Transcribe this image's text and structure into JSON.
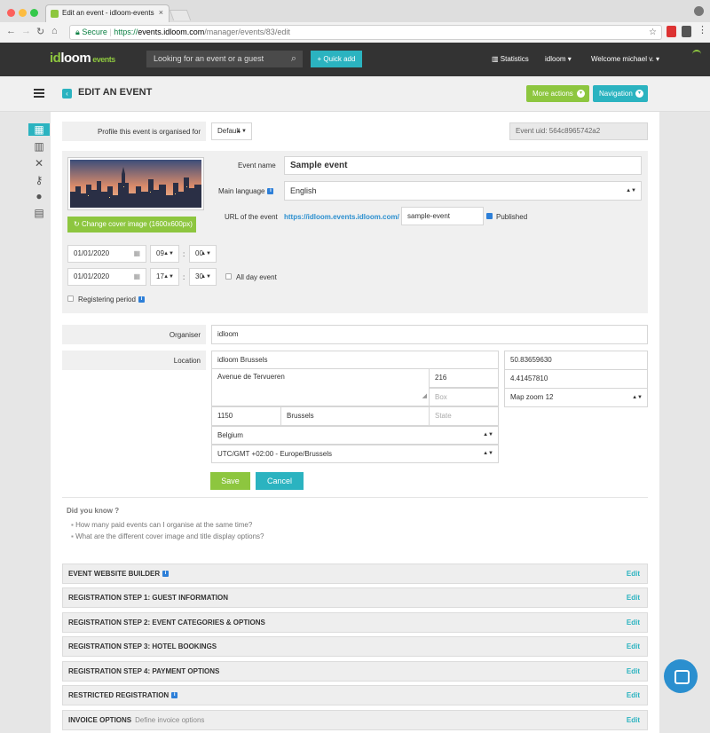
{
  "browser": {
    "tab_title": "Edit an event - idloom-events",
    "url_secure": "Secure",
    "url_protocol": "https://",
    "url_host": "events.idloom.com",
    "url_path": "/manager/events/83/edit"
  },
  "header": {
    "logo_id": "id",
    "logo_loom": "loom",
    "logo_events": "events",
    "search_placeholder": "Looking for an event or a guest",
    "quick_add": "+ Quick add",
    "statistics": "Statistics",
    "account": "idloom ▾",
    "welcome": "Welcome michael v. ▾"
  },
  "subbar": {
    "title": "EDIT AN EVENT",
    "more_actions": "More actions",
    "navigation": "Navigation"
  },
  "sidebar": {
    "icons": [
      "calendar-icon",
      "chart-icon",
      "tools-icon",
      "key-icon",
      "user-icon",
      "card-icon"
    ]
  },
  "form": {
    "profile_label": "Profile this event is organised for",
    "profile_value": "Default",
    "event_uid": "Event uid: 564c8965742a2",
    "cover_button": "Change cover image (1600x600px)",
    "event_name_label": "Event name",
    "event_name_value": "Sample event",
    "main_language_label": "Main language",
    "main_language_value": "English",
    "url_label": "URL of the event",
    "url_prefix": "https://idloom.events.idloom.com/",
    "url_slug": "sample-event",
    "published_label": "Published",
    "start_date": "01/01/2020",
    "start_hour": "09",
    "start_min": "00",
    "end_date": "01/01/2020",
    "end_hour": "17",
    "end_min": "30",
    "colon": ":",
    "all_day_label": "All day event",
    "registering_period_label": "Registering period",
    "organiser_label": "Organiser",
    "organiser_value": "idloom",
    "location_label": "Location",
    "location_name": "idloom Brussels",
    "street": "Avenue de Tervueren",
    "number": "216",
    "box_placeholder": "Box",
    "zip": "1150",
    "city": "Brussels",
    "state_placeholder": "State",
    "country": "Belgium",
    "timezone": "UTC/GMT +02:00 - Europe/Brussels",
    "latitude": "50.83659630",
    "longitude": "4.41457810",
    "map_zoom": "Map zoom 12",
    "save": "Save",
    "cancel": "Cancel"
  },
  "did_you_know": {
    "title": "Did you know ?",
    "items": [
      "How many paid events can I organise at the same time?",
      "What are the different cover image and title display options?"
    ]
  },
  "sections": [
    {
      "label": "EVENT WEBSITE BUILDER",
      "sub": "",
      "edit": "Edit"
    },
    {
      "label": "REGISTRATION STEP 1: GUEST INFORMATION",
      "sub": "",
      "edit": "Edit"
    },
    {
      "label": "REGISTRATION STEP 2: EVENT CATEGORIES & OPTIONS",
      "sub": "",
      "edit": "Edit"
    },
    {
      "label": "REGISTRATION STEP 3: HOTEL BOOKINGS",
      "sub": "",
      "edit": "Edit"
    },
    {
      "label": "REGISTRATION STEP 4: PAYMENT OPTIONS",
      "sub": "",
      "edit": "Edit"
    },
    {
      "label": "RESTRICTED REGISTRATION",
      "sub": "",
      "edit": "Edit"
    },
    {
      "label": "INVOICE OPTIONS",
      "sub": "Define invoice options",
      "edit": "Edit"
    }
  ],
  "colors": {
    "accent_green": "#8dc63f",
    "accent_teal": "#2bb3c0",
    "header_dark": "#333333"
  }
}
